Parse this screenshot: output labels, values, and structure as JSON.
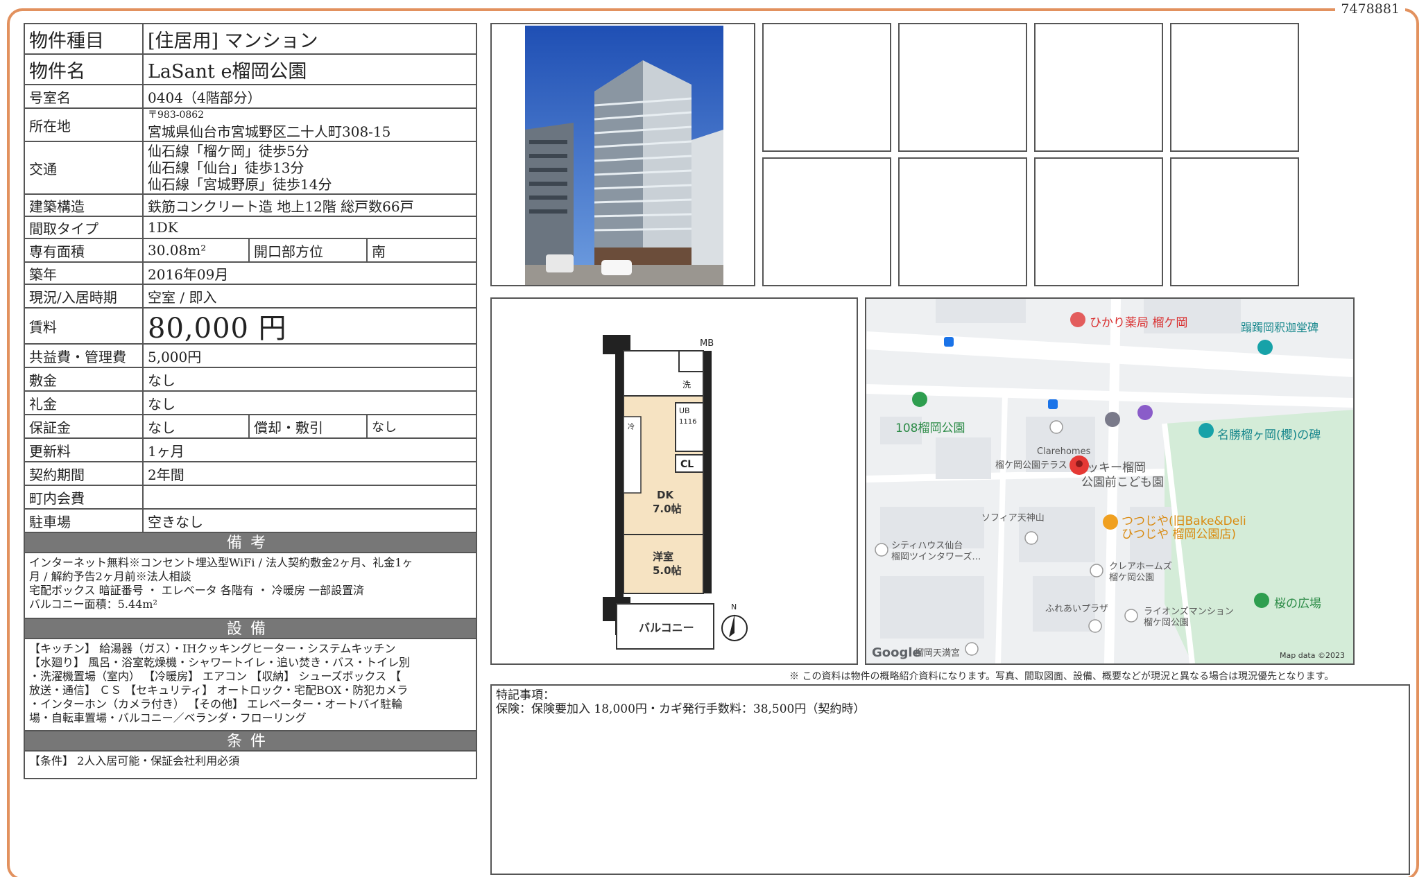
{
  "doc_id": "7478881",
  "property": {
    "type_label": "物件種目",
    "type_value": "[住居用] マンション",
    "name_label": "物件名",
    "name_value": "LaSant e榴岡公園",
    "room_label": "号室名",
    "room_value": "0404（4階部分）",
    "address_label": "所在地",
    "postal": "〒983-0862",
    "address": "宮城県仙台市宮城野区二十人町308-15",
    "access_label": "交通",
    "access": [
      "仙石線「榴ケ岡」徒歩5分",
      "仙石線「仙台」徒歩13分",
      "仙石線「宮城野原」徒歩14分"
    ],
    "structure_label": "建築構造",
    "structure_value": "鉄筋コンクリート造 地上12階 総戸数66戸",
    "layout_label": "間取タイプ",
    "layout_value": "1DK",
    "area_label": "専有面積",
    "area_value": "30.08m²",
    "facing_label": "開口部方位",
    "facing_value": "南",
    "built_label": "築年",
    "built_value": "2016年09月",
    "status_label": "現況/入居時期",
    "status_value": "空室 / 即入",
    "rent_label": "賃料",
    "rent_value": "80,000 円",
    "fee_label": "共益費・管理費",
    "fee_value": "5,000円",
    "deposit_label": "敷金",
    "deposit_value": "なし",
    "key_money_label": "礼金",
    "key_money_value": "なし",
    "guarantee_label": "保証金",
    "guarantee_value": "なし",
    "amortization_label": "償却・敷引",
    "amortization_value": "なし",
    "renewal_label": "更新料",
    "renewal_value": "1ヶ月",
    "contract_label": "契約期間",
    "contract_value": "2年間",
    "town_fee_label": "町内会費",
    "town_fee_value": "",
    "parking_label": "駐車場",
    "parking_value": "空きなし"
  },
  "remarks_band": "備考",
  "remarks_lines": [
    "インターネット無料※コンセント埋込型WiFi / 法人契約敷金2ヶ月、礼金1ヶ",
    "月 / 解約予告2ヶ月前※法人相談",
    "宅配ボックス 暗証番号 ・ エレベータ 各階有 ・ 冷暖房 一部設置済",
    "バルコニー面積：5.44m²"
  ],
  "equipment_band": "設備",
  "equipment_lines": [
    "【キッチン】 給湯器（ガス）・IHクッキングヒーター・システムキッチン",
    "【水廻り】 風呂・浴室乾燥機・シャワートイレ・追い焚き・バス・トイレ別",
    "・洗濯機置場（室内） 【冷暖房】 エアコン 【収納】 シューズボックス 【",
    "放送・通信】 ＣＳ 【セキュリティ】 オートロック・宅配BOX・防犯カメラ",
    "・インターホン（カメラ付き） 【その他】 エレベーター・オートバイ駐輪",
    "場・自転車置場・バルコニー／ベランダ・フローリング"
  ],
  "conditions_band": "条件",
  "conditions_text": "【条件】 2人入居可能・保証会社利用必須",
  "floorplan": {
    "mb": "MB",
    "wash": "洗",
    "ub": "UB",
    "ub_size": "1116",
    "cl": "CL",
    "refrigerator": "冷",
    "dk": "DK",
    "dk_size": "7.0帖",
    "western": "洋室",
    "western_size": "5.0帖",
    "balcony": "バルコニー",
    "north": "N"
  },
  "map": {
    "labels": {
      "pharmacy": "ひかり薬局 榴ケ岡",
      "monument1": "蹋躅岡釈迦堂碑",
      "park108": "108榴岡公園",
      "clarehomes": "Clarehomes",
      "clarehomes2": "榴ケ岡公園テラス",
      "kids1": "ッキー榴岡",
      "kids2": "公園前こども園",
      "monument2": "名勝榴ヶ岡(櫻)の碑",
      "sofia": "ソフィア天神山",
      "tsutsujiya1": "つつじや(旧Bake&Deli",
      "tsutsujiya2": "ひつじや 榴岡公園店)",
      "cityhouse1": "シティハウス仙台",
      "cityhouse2": "榴岡ツインタワーズ…",
      "clare2_1": "クレアホームズ",
      "clare2_2": "榴ケ岡公園",
      "fureai": "ふれあいプラザ",
      "lions1": "ライオンズマンション",
      "lions2": "榴ケ岡公園",
      "sakura": "桜の広場",
      "tenmangu": "榴岡天満宮",
      "google": "Google",
      "mapdata": "Map data ©2023"
    }
  },
  "disclaimer": "※ この資料は物件の概略紹介資料になります。写真、間取図面、設備、概要などが現況と異なる場合は現況優先となります。",
  "special_label": "特記事項：",
  "special_text": "保険：保険要加入 18,000円・カギ発行手数料：38,500円（契約時）"
}
